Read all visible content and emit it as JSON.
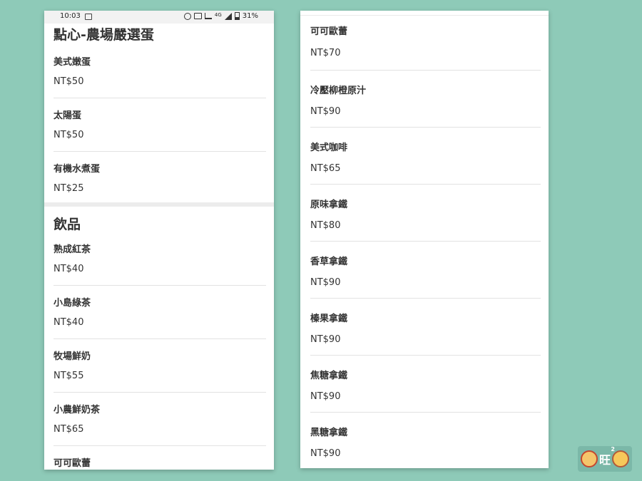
{
  "status_bar": {
    "time": "10:03",
    "network": "4G",
    "battery": "31%",
    "icons": [
      "image-icon",
      "alarm-icon",
      "vibrate-icon",
      "cast-icon",
      "signal-icon",
      "battery-icon"
    ]
  },
  "left_screen": {
    "sections": [
      {
        "title": "點心-農場嚴選蛋",
        "items": [
          {
            "name": "美式嫩蛋",
            "price": "NT$50"
          },
          {
            "name": "太陽蛋",
            "price": "NT$50"
          },
          {
            "name": "有機水煮蛋",
            "price": "NT$25"
          }
        ]
      },
      {
        "title": "飲品",
        "items": [
          {
            "name": "熟成紅茶",
            "price": "NT$40"
          },
          {
            "name": "小島綠茶",
            "price": "NT$40"
          },
          {
            "name": "牧場鮮奶",
            "price": "NT$55"
          },
          {
            "name": "小農鮮奶茶",
            "price": "NT$65"
          },
          {
            "name": "可可歐蕾",
            "price": ""
          }
        ]
      }
    ]
  },
  "right_screen": {
    "items": [
      {
        "name": "可可歐蕾",
        "price": "NT$70"
      },
      {
        "name": "冷壓柳橙原汁",
        "price": "NT$90"
      },
      {
        "name": "美式咖啡",
        "price": "NT$65"
      },
      {
        "name": "原味拿鐵",
        "price": "NT$80"
      },
      {
        "name": "香草拿鐵",
        "price": "NT$90"
      },
      {
        "name": "榛果拿鐵",
        "price": "NT$90"
      },
      {
        "name": "焦糖拿鐵",
        "price": "NT$90"
      },
      {
        "name": "黑糖拿鐵",
        "price": "NT$90"
      }
    ]
  },
  "logo": {
    "text": "旺",
    "sup": "2"
  },
  "colors": {
    "background": "#8ecab8",
    "text": "#333333",
    "divider": "#e2e2e2"
  }
}
